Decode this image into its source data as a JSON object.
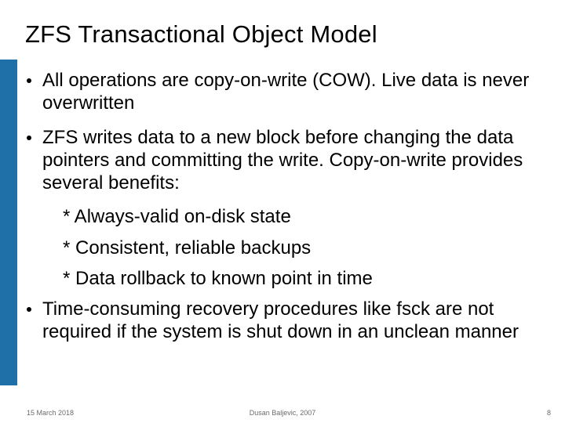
{
  "title": "ZFS Transactional Object Model",
  "bullets": [
    {
      "text": "All operations are copy-on-write (COW). Live data is never overwritten"
    },
    {
      "text": "ZFS writes data to a new block before changing the data pointers and committing the write. Copy-on-write provides several benefits:"
    }
  ],
  "sub_items": [
    "* Always-valid on-disk state",
    "* Consistent, reliable backups",
    "* Data rollback to known point in time"
  ],
  "bullet3": "Time-consuming recovery procedures like fsck are not required if the system is shut down in an unclean manner",
  "footer": {
    "left": "15 March 2018",
    "center": "Dusan Baljevic, 2007",
    "right": "8"
  },
  "accent_color": "#1f6fa8"
}
